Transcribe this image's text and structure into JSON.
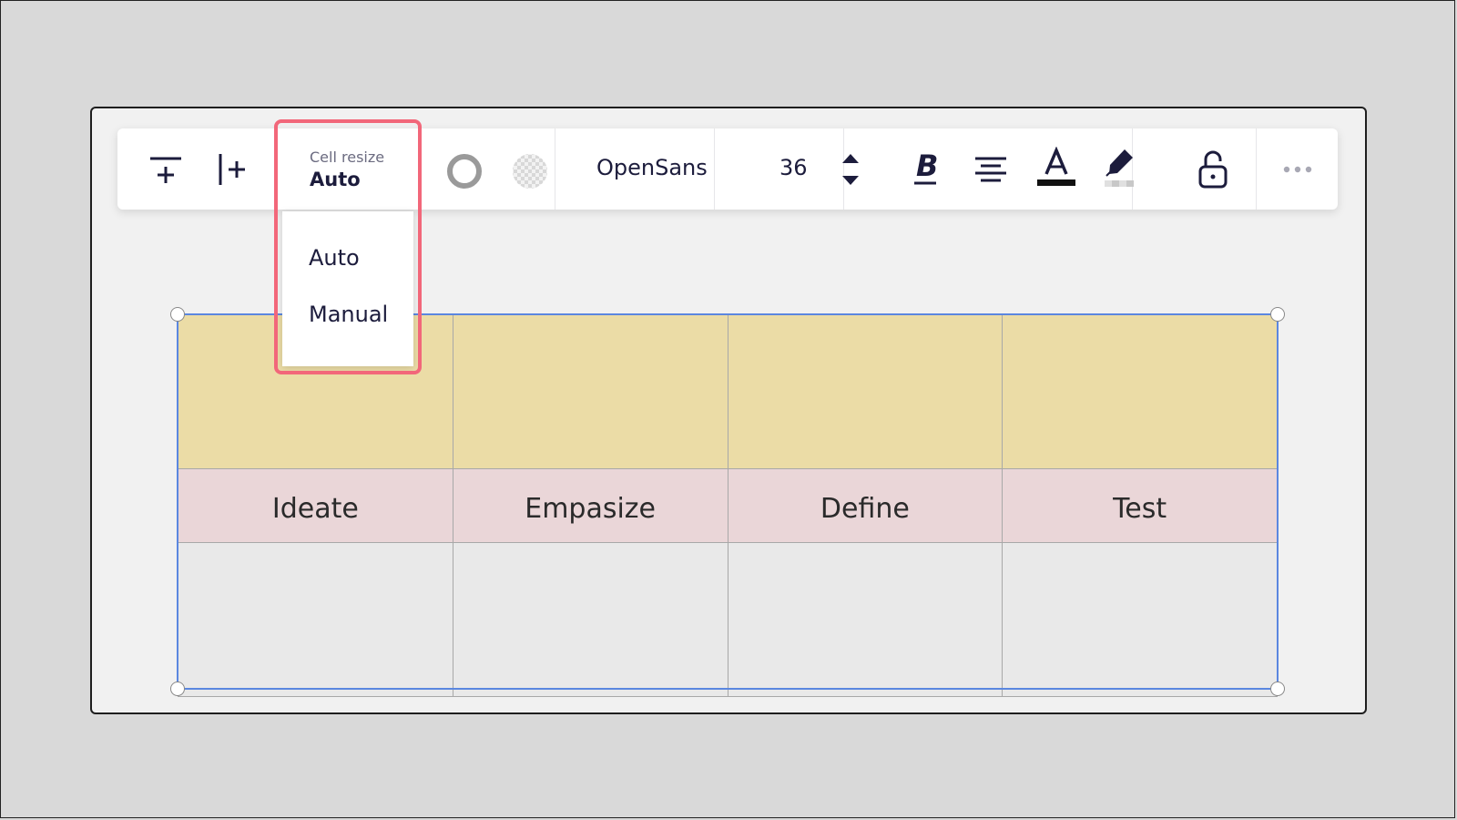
{
  "toolbar": {
    "cell_resize": {
      "label": "Cell resize",
      "value": "Auto"
    },
    "font": {
      "name": "OpenSans",
      "size": "36"
    }
  },
  "dropdown": {
    "options": [
      {
        "label": "Auto"
      },
      {
        "label": "Manual"
      }
    ]
  },
  "table": {
    "rows": [
      [
        "",
        "",
        "",
        ""
      ],
      [
        "Ideate",
        "Empasize",
        "Define",
        "Test"
      ],
      [
        "",
        "",
        "",
        ""
      ]
    ]
  },
  "colors": {
    "highlight": "#f2677a",
    "selection": "#5b87e0",
    "header_row": "#ebdca6",
    "label_row": "#ead6d8",
    "body_row": "#e9e9e9",
    "text_color_underline": "#111111"
  },
  "icons": {
    "add_row": "add-row-icon",
    "add_column": "add-column-icon",
    "border_style": "border-circle-icon",
    "fill_transparent": "transparent-fill-icon",
    "size_stepper": "stepper-icon",
    "bold": "bold-icon",
    "align": "align-center-icon",
    "text_color": "text-color-icon",
    "highlight": "highlighter-icon",
    "lock": "unlock-icon",
    "more": "more-icon"
  }
}
